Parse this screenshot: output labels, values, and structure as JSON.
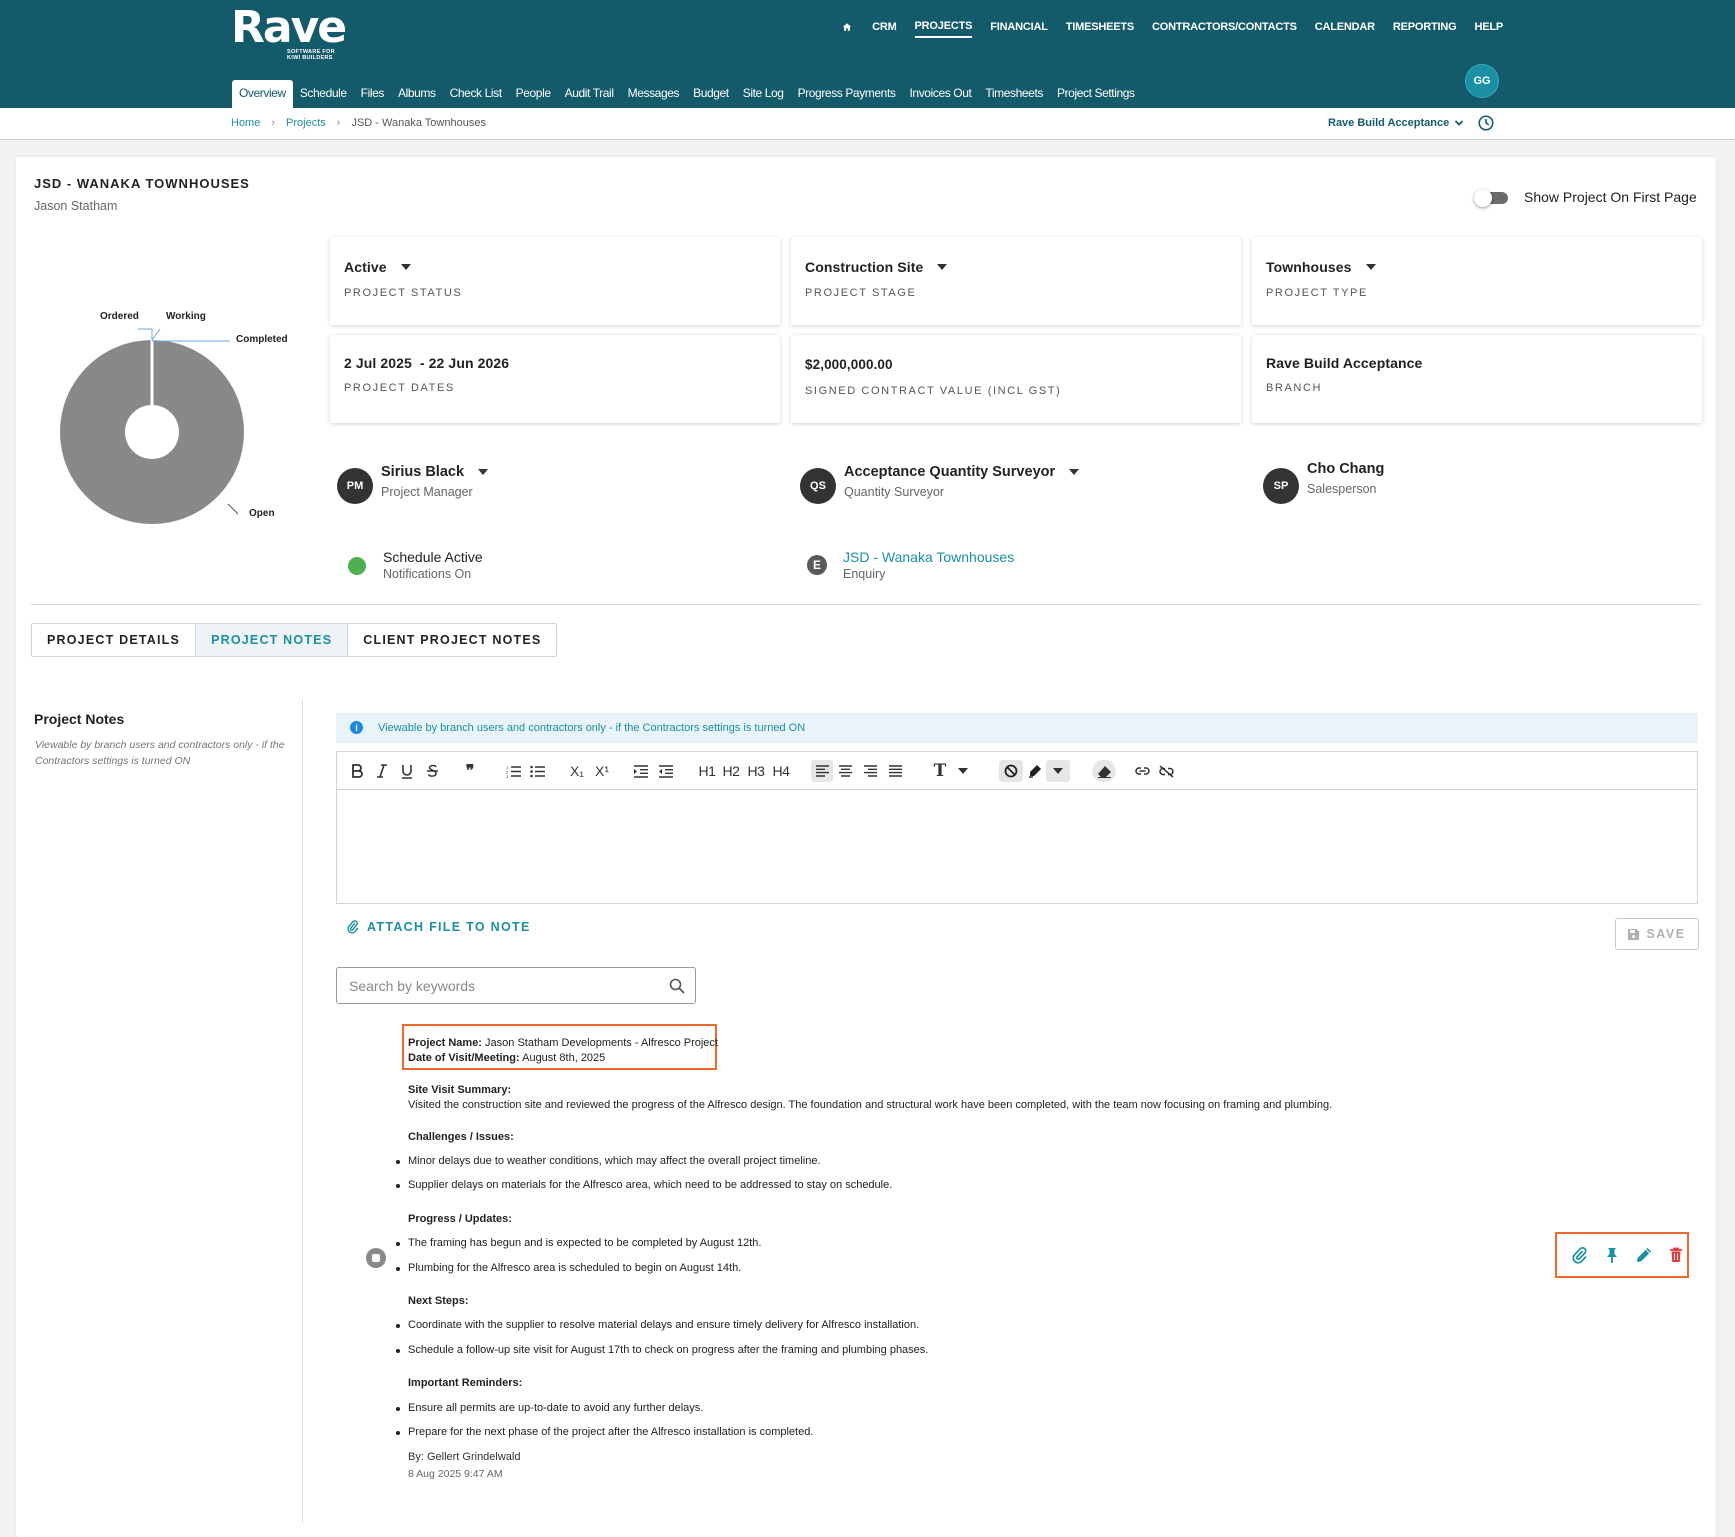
{
  "header": {
    "logo": {
      "word": "Rave",
      "tagline": "SOFTWARE FOR KIWI BUILDERS"
    },
    "main_nav": [
      "CRM",
      "PROJECTS",
      "FINANCIAL",
      "TIMESHEETS",
      "CONTRACTORS/CONTACTS",
      "CALENDAR",
      "REPORTING",
      "HELP"
    ],
    "main_nav_active": "PROJECTS",
    "sub_nav": [
      "Overview",
      "Schedule",
      "Files",
      "Albums",
      "Check List",
      "People",
      "Audit Trail",
      "Messages",
      "Budget",
      "Site Log",
      "Progress Payments",
      "Invoices Out",
      "Timesheets",
      "Project Settings"
    ],
    "sub_nav_active": "Overview",
    "user_initials": "GG",
    "brand_color": "#135b6b",
    "accent_color": "#1b8fa4"
  },
  "breadcrumb": {
    "home": "Home",
    "projects": "Projects",
    "current": "JSD - Wanaka Townhouses",
    "branch_selector": "Rave Build Acceptance"
  },
  "project": {
    "title": "JSD - WANAKA TOWNHOUSES",
    "client": "Jason Statham",
    "show_on_first_page_label": "Show Project On First Page",
    "show_on_first_page": false
  },
  "chart_data": {
    "type": "pie",
    "categories": [
      "Ordered",
      "Working",
      "Completed",
      "Open"
    ],
    "values": [
      0,
      0,
      0,
      100
    ],
    "colors": [
      "#888888",
      "#888888",
      "#6fa8d6",
      "#888888"
    ]
  },
  "info": {
    "status": {
      "value": "Active",
      "label": "PROJECT STATUS"
    },
    "stage": {
      "value": "Construction Site",
      "label": "PROJECT STAGE"
    },
    "type": {
      "value": "Townhouses",
      "label": "PROJECT TYPE"
    },
    "dates": {
      "value": "2 Jul 2025  - 22 Jun 2026",
      "label": "PROJECT DATES"
    },
    "contract": {
      "value": "$2,000,000.00",
      "label": "SIGNED CONTRACT VALUE (INCL GST)"
    },
    "branch": {
      "value": "Rave Build Acceptance",
      "label": "BRANCH"
    }
  },
  "people": [
    {
      "initials": "PM",
      "name": "Sirius Black",
      "role": "Project Manager"
    },
    {
      "initials": "QS",
      "name": "Acceptance Quantity Surveyor",
      "role": "Quantity Surveyor"
    },
    {
      "initials": "SP",
      "name": "Cho Chang",
      "role": "Salesperson"
    }
  ],
  "schedule": {
    "title": "Schedule Active",
    "sub": "Notifications On",
    "status_color": "#4caf50"
  },
  "enquiry": {
    "icon_letter": "E",
    "link": "JSD - Wanaka Townhouses",
    "sub": "Enquiry"
  },
  "tabs": [
    "PROJECT DETAILS",
    "PROJECT NOTES",
    "CLIENT PROJECT NOTES"
  ],
  "tabs_active": "PROJECT NOTES",
  "notes_panel": {
    "heading": "Project Notes",
    "description": "Viewable by branch users and contractors only - if the Contractors settings is turned ON",
    "banner": "Viewable by branch users and contractors only - if the Contractors settings is turned ON",
    "toolbar": {
      "quote": "❞",
      "sub": "X₁",
      "sup": "X¹",
      "h1": "H1",
      "h2": "H2",
      "h3": "H3",
      "h4": "H4",
      "font": "T"
    },
    "attach_label": "ATTACH FILE TO NOTE",
    "save_label": "SAVE",
    "search_placeholder": "Search by keywords"
  },
  "note": {
    "project_name_label": "Project Name:",
    "project_name": "Jason Statham Developments - Alfresco Project",
    "date_label": "Date of Visit/Meeting:",
    "date": "August 8th, 2025",
    "summary_heading": "Site Visit Summary:",
    "summary": "Visited the construction site and reviewed the progress of the Alfresco design. The foundation and structural work have been completed, with the team now focusing on framing and plumbing.",
    "challenges_heading": "Challenges / Issues:",
    "challenges": [
      "Minor delays due to weather conditions, which may affect the overall project timeline.",
      "Supplier delays on materials for the Alfresco area, which need to be addressed to stay on schedule."
    ],
    "progress_heading": "Progress / Updates:",
    "progress": [
      "The framing has begun and is expected to be completed by August 12th.",
      "Plumbing for the Alfresco area is scheduled to begin on August 14th."
    ],
    "next_heading": "Next Steps:",
    "next": [
      "Coordinate with the supplier to resolve material delays and ensure timely delivery for Alfresco installation.",
      "Schedule a follow-up site visit for August 17th to check on progress after the framing and plumbing phases."
    ],
    "reminders_heading": "Important Reminders:",
    "reminders": [
      "Ensure all permits are up-to-date to avoid any further delays.",
      "Prepare for the next phase of the project after the Alfresco installation is completed."
    ],
    "author": "By: Gellert Grindelwald",
    "timestamp": "8 Aug 2025 9:47 AM"
  }
}
